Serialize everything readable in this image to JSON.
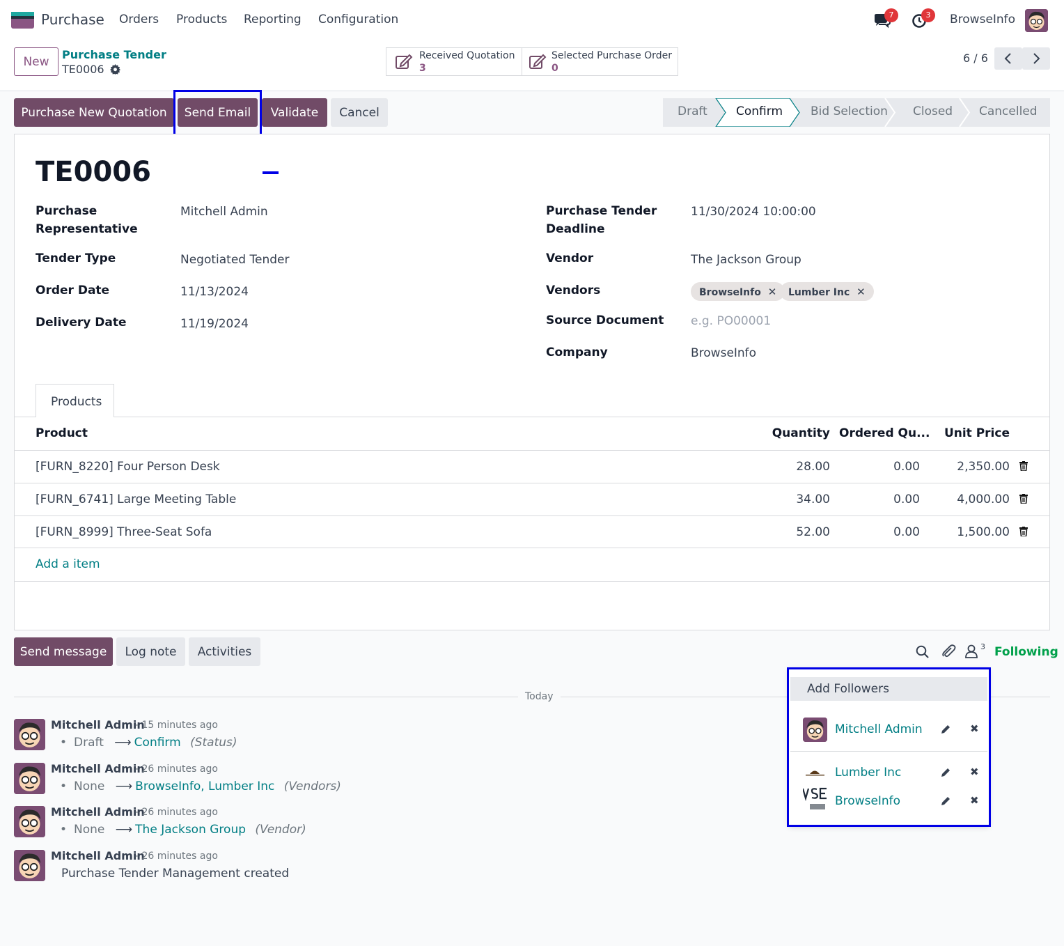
{
  "navbar": {
    "app_name": "Purchase",
    "menu": [
      "Orders",
      "Products",
      "Reporting",
      "Configuration"
    ],
    "messages_badge": "7",
    "activities_badge": "3",
    "user_name": "BrowseInfo"
  },
  "control_panel": {
    "new_label": "New",
    "breadcrumb_parent": "Purchase Tender",
    "breadcrumb_current": "TE0006",
    "smart_buttons": [
      {
        "label": "Received Quotation",
        "value": "3"
      },
      {
        "label": "Selected Purchase Order",
        "value": "0"
      }
    ],
    "pager": "6 / 6"
  },
  "actions": {
    "buttons": [
      "Purchase New Quotation",
      "Send Email",
      "Validate",
      "Cancel"
    ]
  },
  "statusbar": {
    "stages": [
      "Draft",
      "Confirm",
      "Bid Selection",
      "Closed",
      "Cancelled"
    ],
    "active": "Confirm"
  },
  "form": {
    "name": "TE0006",
    "fields_left": [
      {
        "label": "Purchase Representative",
        "value": "Mitchell Admin"
      },
      {
        "label": "Tender Type",
        "value": "Negotiated Tender"
      },
      {
        "label": "Order Date",
        "value": "11/13/2024"
      },
      {
        "label": "Delivery Date",
        "value": "11/19/2024"
      }
    ],
    "fields_right": [
      {
        "label": "Purchase Tender Deadline",
        "value": "11/30/2024 10:00:00"
      },
      {
        "label": "Vendor",
        "value": "The Jackson Group"
      },
      {
        "label": "Vendors",
        "tags": [
          "BrowseInfo",
          "Lumber Inc"
        ]
      },
      {
        "label": "Source Document",
        "placeholder": "e.g. PO00001"
      },
      {
        "label": "Company",
        "value": "BrowseInfo"
      }
    ],
    "tab": "Products",
    "table": {
      "headers": [
        "Product",
        "Quantity",
        "Ordered Qu...",
        "Unit Price"
      ],
      "rows": [
        [
          "[FURN_8220] Four Person Desk",
          "28.00",
          "0.00",
          "2,350.00"
        ],
        [
          "[FURN_6741] Large Meeting Table",
          "34.00",
          "0.00",
          "4,000.00"
        ],
        [
          "[FURN_8999] Three-Seat Sofa",
          "52.00",
          "0.00",
          "1,500.00"
        ]
      ],
      "add_item": "Add a item"
    }
  },
  "chatter": {
    "buttons": [
      "Send message",
      "Log note",
      "Activities"
    ],
    "followers_count": "3",
    "following_label": "Following",
    "date_separator": "Today",
    "messages": [
      {
        "author": "Mitchell Admin",
        "time": "- 15 minutes ago",
        "old": "Draft",
        "new": "Confirm",
        "field": "(Status)"
      },
      {
        "author": "Mitchell Admin",
        "time": "- 26 minutes ago",
        "old": "None",
        "new": "BrowseInfo, Lumber Inc",
        "field": "(Vendors)"
      },
      {
        "author": "Mitchell Admin",
        "time": "- 26 minutes ago",
        "old": "None",
        "new": "The Jackson Group",
        "field": "(Vendor)"
      },
      {
        "author": "Mitchell Admin",
        "time": "- 26 minutes ago",
        "text": "Purchase Tender Management created"
      }
    ]
  },
  "followers_dropdown": {
    "add_label": "Add Followers",
    "followers": [
      "Mitchell Admin",
      "Lumber Inc",
      "BrowseInfo"
    ]
  },
  "colors": {
    "primary": "#714b67",
    "link": "#017e84",
    "following": "#00a04a",
    "highlight": "#0000e6",
    "badge": "#e0363a"
  }
}
